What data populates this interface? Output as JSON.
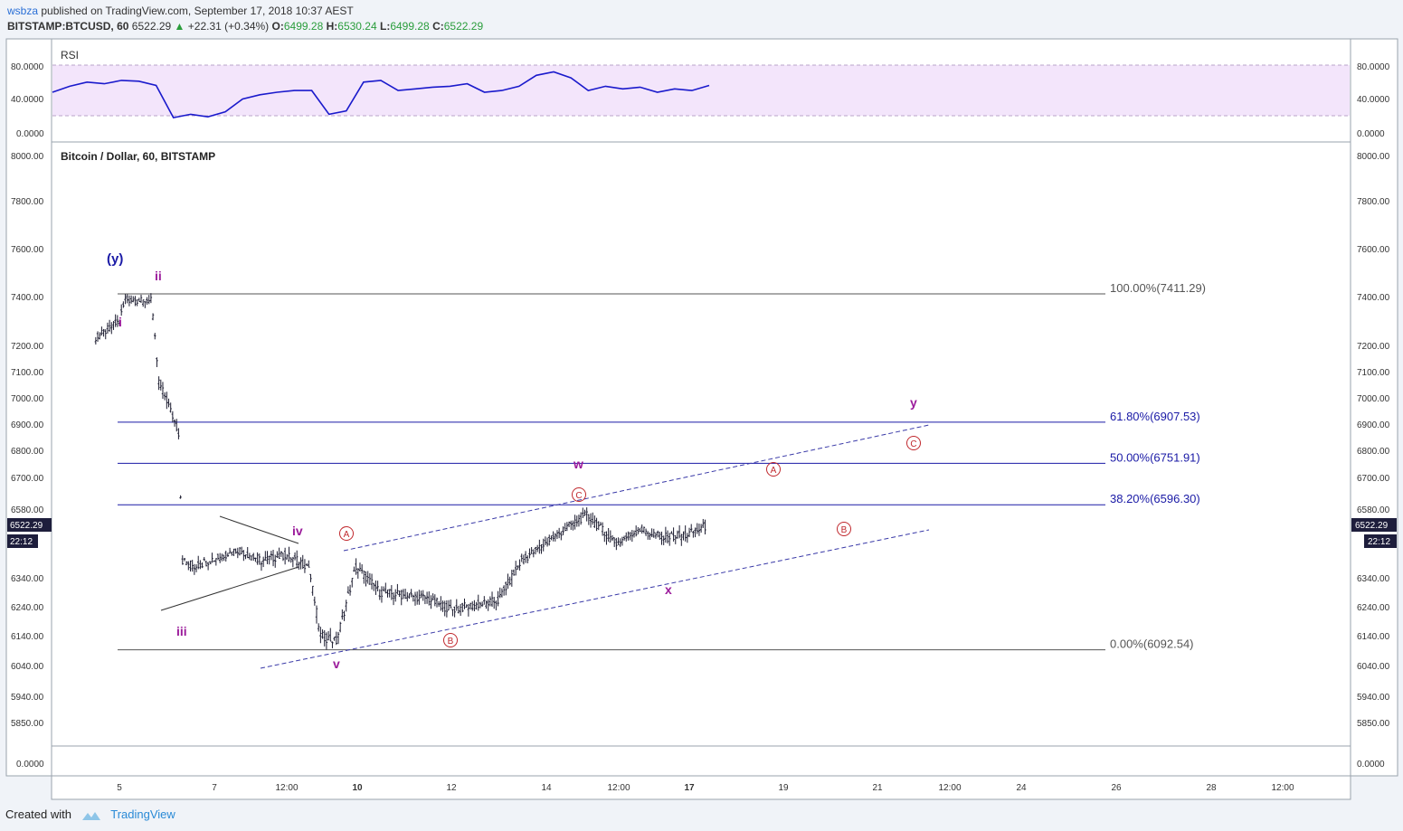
{
  "header": {
    "user": "wsbza",
    "published": "published on TradingView.com, September 17, 2018 10:37 AEST",
    "symbol": "BITSTAMP:BTCUSD, 60",
    "last": "6522.29",
    "change": "+22.31 (+0.34%)",
    "open_label": "O:",
    "open": "6499.28",
    "high_label": "H:",
    "high": "6530.24",
    "low_label": "L:",
    "low": "6499.28",
    "close_label": "C:",
    "close": "6522.29"
  },
  "rsi_panel": {
    "title": "RSI",
    "ticks": [
      "80.0000",
      "40.0000",
      "0.0000"
    ],
    "band": [
      20,
      80
    ]
  },
  "main_panel": {
    "title": "Bitcoin / Dollar, 60, BITSTAMP",
    "price_ticks": [
      "8000.00",
      "7800.00",
      "7600.00",
      "7400.00",
      "7200.00",
      "7100.00",
      "7000.00",
      "6900.00",
      "6800.00",
      "6700.00",
      "6580.00",
      "6340.00",
      "6240.00",
      "6140.00",
      "6040.00",
      "5940.00",
      "5850.00"
    ],
    "last_price_tag": "6522.29",
    "countdown_tag": "22:12"
  },
  "volume_panel": {
    "tick": "0.0000"
  },
  "x_axis": {
    "labels": [
      "5",
      "7",
      "12:00",
      "10",
      "12",
      "14",
      "12:00",
      "17",
      "19",
      "21",
      "12:00",
      "24",
      "26",
      "28",
      "12:00"
    ]
  },
  "fib_levels": [
    {
      "label": "100.00%(7411.29)",
      "price": 7411.29,
      "color": "#555555"
    },
    {
      "label": "61.80%(6907.53)",
      "price": 6907.53,
      "color": "#1a1aa6"
    },
    {
      "label": "50.00%(6751.91)",
      "price": 6751.91,
      "color": "#1a1aa6"
    },
    {
      "label": "38.20%(6596.30)",
      "price": 6596.3,
      "color": "#1a1aa6"
    },
    {
      "label": "0.00%(6092.54)",
      "price": 6092.54,
      "color": "#555555"
    }
  ],
  "wave_labels": [
    {
      "text": "(y)",
      "color": "#1a1aa6"
    },
    {
      "text": "ii",
      "color": "#9b1b9b"
    },
    {
      "text": "i",
      "color": "#9b1b9b"
    },
    {
      "text": "iii",
      "color": "#9b1b9b"
    },
    {
      "text": "iv",
      "color": "#9b1b9b"
    },
    {
      "text": "v",
      "color": "#9b1b9b"
    },
    {
      "text": "w",
      "color": "#9b1b9b"
    },
    {
      "text": "x",
      "color": "#9b1b9b"
    },
    {
      "text": "y",
      "color": "#9b1b9b"
    },
    {
      "text": "A",
      "color": "#c0282d"
    },
    {
      "text": "B",
      "color": "#c0282d"
    },
    {
      "text": "C",
      "color": "#c0282d"
    },
    {
      "text": "A",
      "color": "#c0282d"
    },
    {
      "text": "B",
      "color": "#c0282d"
    },
    {
      "text": "C",
      "color": "#c0282d"
    }
  ],
  "footer": {
    "created": "Created with",
    "brand": "TradingView"
  },
  "colors": {
    "rsi_line": "#1a1acc",
    "rsi_band": "#f3e5fb",
    "candle": "#1a1a2e",
    "channel": "#3a3aa8",
    "tag_bg": "#1e1e3c"
  },
  "chart_data": {
    "type": "line",
    "title": "Bitcoin / Dollar, 60, BITSTAMP",
    "ylim": [
      5800,
      8050
    ],
    "price_path": [
      {
        "date": "Sep 4 12:00",
        "price": 7230
      },
      {
        "date": "Sep 5 00:00",
        "price": 7300
      },
      {
        "date": "Sep 5 03:00",
        "price": 7390
      },
      {
        "date": "Sep 5 12:00",
        "price": 7380
      },
      {
        "date": "Sep 5 16:00",
        "price": 7395
      },
      {
        "date": "Sep 5 20:00",
        "price": 7060
      },
      {
        "date": "Sep 6 00:00",
        "price": 6990
      },
      {
        "date": "Sep 6 06:00",
        "price": 6870
      },
      {
        "date": "Sep 6 08:00",
        "price": 6400
      },
      {
        "date": "Sep 6 14:00",
        "price": 6380
      },
      {
        "date": "Sep 7 12:00",
        "price": 6440
      },
      {
        "date": "Sep 8 00:00",
        "price": 6400
      },
      {
        "date": "Sep 8 12:00",
        "price": 6420
      },
      {
        "date": "Sep 9 00:00",
        "price": 6380
      },
      {
        "date": "Sep 9 06:00",
        "price": 6140
      },
      {
        "date": "Sep 9 14:00",
        "price": 6120
      },
      {
        "date": "Sep 10 00:00",
        "price": 6380
      },
      {
        "date": "Sep 10 12:00",
        "price": 6290
      },
      {
        "date": "Sep 11 12:00",
        "price": 6270
      },
      {
        "date": "Sep 12 00:00",
        "price": 6230
      },
      {
        "date": "Sep 13 00:00",
        "price": 6260
      },
      {
        "date": "Sep 13 12:00",
        "price": 6400
      },
      {
        "date": "Sep 14 12:00",
        "price": 6520
      },
      {
        "date": "Sep 14 21:00",
        "price": 6560
      },
      {
        "date": "Sep 15 12:00",
        "price": 6460
      },
      {
        "date": "Sep 16 00:00",
        "price": 6510
      },
      {
        "date": "Sep 16 12:00",
        "price": 6480
      },
      {
        "date": "Sep 17 00:00",
        "price": 6490
      },
      {
        "date": "Sep 17 10:00",
        "price": 6522.29
      }
    ],
    "rsi_path": [
      48,
      55,
      60,
      58,
      62,
      61,
      56,
      18,
      22,
      19,
      25,
      40,
      45,
      48,
      50,
      50,
      22,
      26,
      60,
      62,
      50,
      52,
      54,
      55,
      58,
      48,
      50,
      55,
      68,
      72,
      65,
      50,
      55,
      52,
      54,
      48,
      52,
      50,
      56
    ]
  }
}
